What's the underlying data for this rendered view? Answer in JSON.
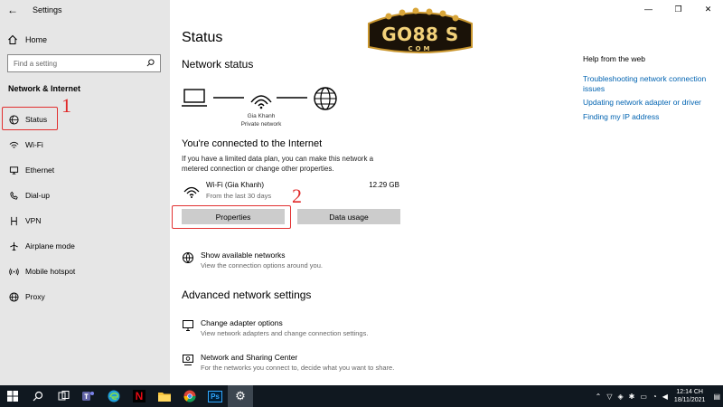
{
  "window": {
    "title": "Settings",
    "back_glyph": "←",
    "minimize_glyph": "—",
    "maximize_glyph": "❐",
    "close_glyph": "✕"
  },
  "sidebar": {
    "home": "Home",
    "search_placeholder": "Find a setting",
    "section": "Network & Internet",
    "items": [
      {
        "label": "Status",
        "icon": "status-globe-icon"
      },
      {
        "label": "Wi-Fi",
        "icon": "wifi-icon"
      },
      {
        "label": "Ethernet",
        "icon": "ethernet-icon"
      },
      {
        "label": "Dial-up",
        "icon": "dialup-icon"
      },
      {
        "label": "VPN",
        "icon": "vpn-icon"
      },
      {
        "label": "Airplane mode",
        "icon": "airplane-icon"
      },
      {
        "label": "Mobile hotspot",
        "icon": "hotspot-icon"
      },
      {
        "label": "Proxy",
        "icon": "globe-icon"
      }
    ],
    "selected": "Status"
  },
  "annotations": {
    "one": "1",
    "two": "2"
  },
  "logo": {
    "main": "GO88",
    "suffix": "S",
    "sub": "COM"
  },
  "main": {
    "title": "Status",
    "network_status": "Network status",
    "network_name": "Gia Khanh",
    "network_type": "Private network",
    "connected_heading": "You're connected to the Internet",
    "connected_text": "If you have a limited data plan, you can make this network a metered connection or change other properties.",
    "connection": {
      "name": "Wi-Fi (Gia Khanh)",
      "period": "From the last 30 days",
      "usage": "12.29 GB"
    },
    "properties_button": "Properties",
    "data_usage_button": "Data usage",
    "show_networks": {
      "title": "Show available networks",
      "desc": "View the connection options around you."
    },
    "advanced_heading": "Advanced network settings",
    "change_adapter": {
      "title": "Change adapter options",
      "desc": "View network adapters and change connection settings."
    },
    "sharing_center": {
      "title": "Network and Sharing Center",
      "desc": "For the networks you connect to, decide what you want to share."
    }
  },
  "help": {
    "heading": "Help from the web",
    "links": [
      "Troubleshooting network connection issues",
      "Updating network adapter or driver",
      "Finding my IP address"
    ]
  },
  "taskbar": {
    "apps": [
      "start-icon",
      "search-icon",
      "task-view-icon",
      "teams-icon",
      "edge-icon",
      "netflix-icon",
      "file-explorer-icon",
      "chrome-icon",
      "photoshop-icon",
      "settings-icon"
    ],
    "time": "12:14 CH",
    "date": "18/11/2021",
    "netflix_letter": "N",
    "ps_label": "Ps"
  },
  "colors": {
    "accent_link": "#0063b1",
    "annotation": "#e02828",
    "sidebar_bg": "#e6e6e6",
    "taskbar_bg": "#101820"
  }
}
